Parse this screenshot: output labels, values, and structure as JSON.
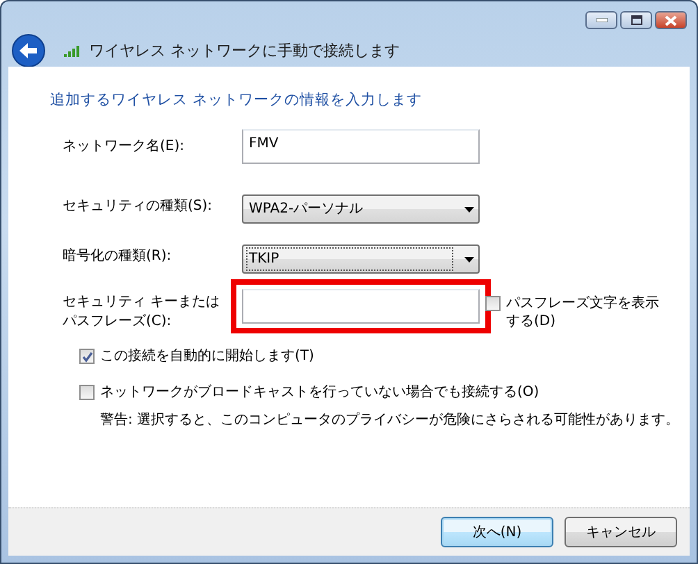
{
  "window": {
    "title": "ワイヤレス ネットワークに手動で接続します"
  },
  "heading": "追加するワイヤレス ネットワークの情報を入力します",
  "fields": [
    {
      "kind": "text",
      "label_lines": [
        "ネットワーク名(E):"
      ],
      "value": "FMV"
    },
    {
      "kind": "dropdown",
      "label_lines": [
        "セキュリティの種類(S):"
      ],
      "value": "WPA2-パーソナル",
      "focused": false
    },
    {
      "kind": "dropdown",
      "label_lines": [
        "暗号化の種類(R):"
      ],
      "value": "TKIP",
      "focused": true
    },
    {
      "kind": "password",
      "label_lines": [
        "セキュリティ キーまたは",
        "パスフレーズ(C):"
      ],
      "highlighted": true,
      "side_checkbox": {
        "label_lines": [
          "パスフレーズ文字を表示",
          "する(D)"
        ],
        "checked": false
      }
    }
  ],
  "checkboxes": [
    {
      "label": "この接続を自動的に開始します(T)",
      "checked": true
    },
    {
      "label": "ネットワークがブロードキャストを行っていない場合でも接続する(O)",
      "checked": false
    }
  ],
  "warning": "警告: 選択すると、このコンピュータのプライバシーが危険にさらされる可能性があります。",
  "buttons": [
    {
      "label": "次へ(N)",
      "default": true
    },
    {
      "label": "キャンセル",
      "default": false
    }
  ]
}
